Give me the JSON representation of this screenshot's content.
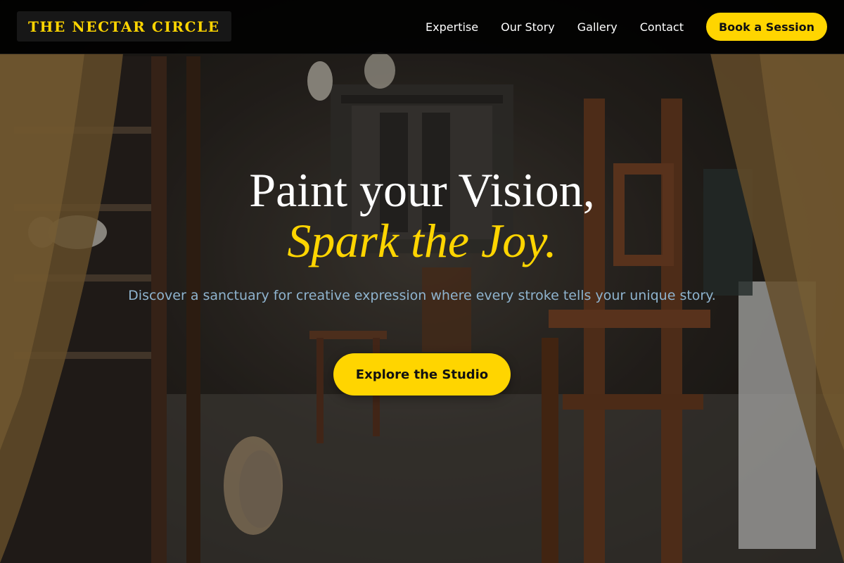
{
  "header": {
    "logo_text": "THE NECTAR CIRCLE",
    "nav": [
      {
        "label": "Expertise"
      },
      {
        "label": "Our Story"
      },
      {
        "label": "Gallery"
      },
      {
        "label": "Contact"
      }
    ],
    "book_button_label": "Book a Session"
  },
  "hero": {
    "headline_line1": "Paint your Vision,",
    "headline_line2": "Spark the Joy.",
    "subtitle": "Discover a sanctuary for creative expression where every stroke tells your unique story.",
    "cta_label": "Explore the Studio"
  },
  "colors": {
    "accent": "#ffd500",
    "header_bg": "#000000",
    "subtitle_text": "#8fb4cf",
    "button_text": "#111111"
  }
}
